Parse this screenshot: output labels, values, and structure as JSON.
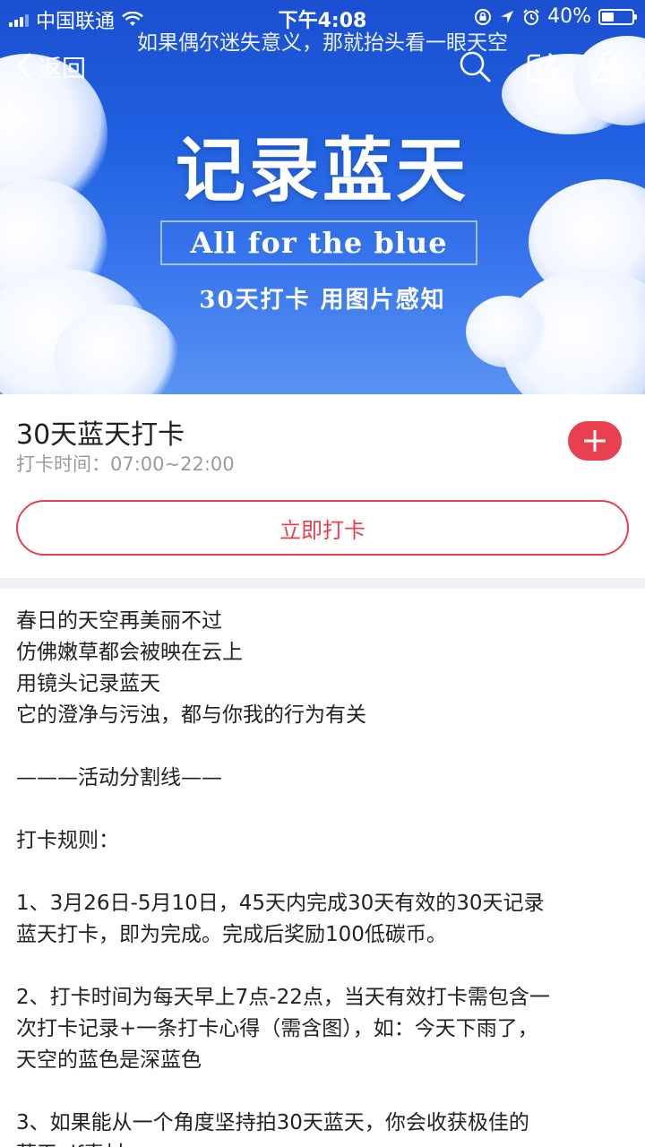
{
  "status_bar": {
    "carrier": "中国联通",
    "time": "下午4:08",
    "battery_percent": "40%",
    "battery_level": 0.4
  },
  "banner": {
    "caption": "如果偶尔迷失意义，那就抬头看一眼天空",
    "title": "记录蓝天",
    "subtitle": "All for the blue",
    "tagline": "30天打卡 用图片感知"
  },
  "nav": {
    "back_label": "返回",
    "icons": [
      "search-icon",
      "share-icon",
      "profile-icon"
    ]
  },
  "activity": {
    "title": "30天蓝天打卡",
    "time_label": "打卡时间：07:00~22:00",
    "checkin_label": "立即打卡"
  },
  "description": {
    "intro": [
      "春日的天空再美丽不过",
      "仿佛嫩草都会被映在云上",
      "用镜头记录蓝天",
      "它的澄净与污浊，都与你我的行为有关"
    ],
    "separator": "———活动分割线——",
    "rules_heading": "打卡规则：",
    "rule1_line1": "1、3月26日-5月10日，45天内完成30天有效的30天记录",
    "rule1_line2": "蓝天打卡，即为完成。完成后奖励100低碳币。",
    "rule2_line1": "2、打卡时间为每天早上7点-22点，当天有效打卡需包含一",
    "rule2_line2": "次打卡记录+一条打卡心得（需含图），如：今天下雨了，",
    "rule2_line3": "天空的蓝色是深蓝色",
    "rule3_line1": "3、如果能从一个角度坚持拍30天蓝天，你会收获极佳的",
    "rule3_line2": "蓝天gif素材"
  },
  "colors": {
    "accent": "#e8404f",
    "sky_top": "#1a4fd0",
    "sky_bottom": "#5a93f2",
    "muted_text": "#9b9b9b",
    "band": "#efeff4"
  }
}
